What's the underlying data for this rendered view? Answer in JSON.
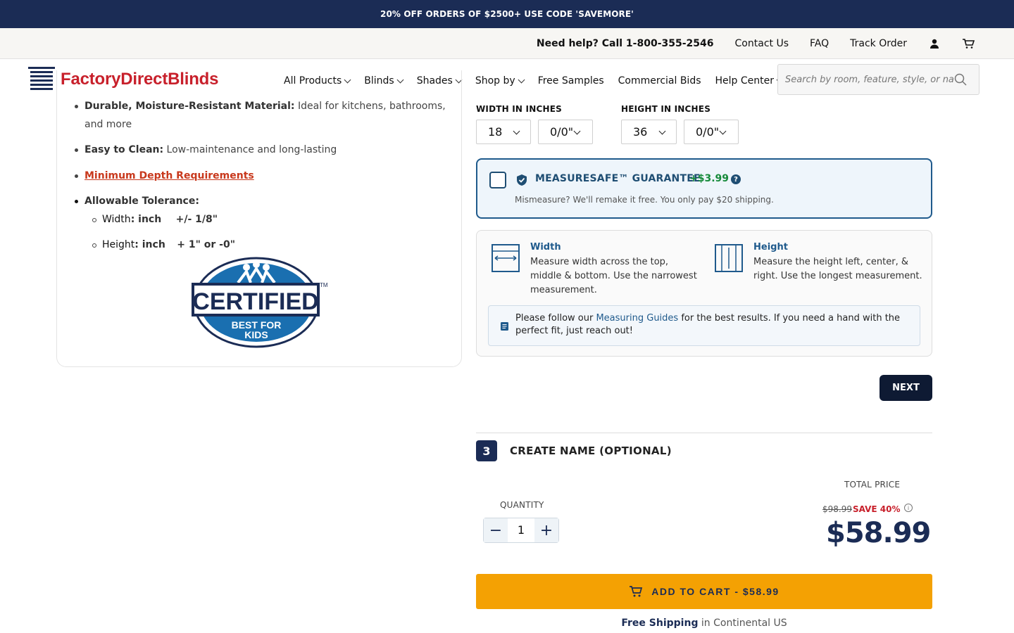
{
  "promo": "20% OFF ORDERS OF $2500+ USE CODE 'SAVEMORE'",
  "util": {
    "help": "Need help? Call 1-800-355-2546",
    "contact": "Contact Us",
    "faq": "FAQ",
    "track": "Track Order",
    "account_icon": "user-icon",
    "cart_icon": "cart-icon"
  },
  "brand": {
    "name": "FactoryDirectBlinds",
    "color": "#c8202b",
    "navy": "#1b2c55"
  },
  "nav": {
    "items": [
      "All Products",
      "Blinds",
      "Shades",
      "Shop by",
      "Free Samples",
      "Commercial Bids",
      "Help Center"
    ],
    "search_placeholder": "Search by room, feature, style, or name"
  },
  "features": {
    "durable_bold": "Durable, Moisture-Resistant Material:",
    "durable_rest1": " Ideal for kitchens, bathrooms,",
    "durable_rest2": "and more",
    "clean_bold": "Easy to Clean:",
    "clean_rest": " Low-maintenance and long-lasting",
    "depth_link": "Minimum Depth Requirements",
    "tolerance": "Allowable Tolerance:",
    "width_label": "Width",
    "width_unit": ": inch",
    "width_val": "+/- 1/8\"",
    "height_label": "Height",
    "height_unit": ": inch",
    "height_val": "+ 1\" or -0\""
  },
  "badge": {
    "line1": "CERTIFIED",
    "line2": "BEST FOR",
    "line3": "KIDS",
    "tm": "TM"
  },
  "dimensions": {
    "width_label": "WIDTH IN INCHES",
    "height_label": "HEIGHT IN INCHES",
    "width_whole": "18",
    "width_fraction": "0/0\"",
    "height_whole": "36",
    "height_fraction": "0/0\""
  },
  "guarantee": {
    "title": "MEASURESAFE™ GUARANTEE",
    "price": "+$3.99",
    "help_icon": "?",
    "subtitle": "Mismeasure? We'll remake it free. You only pay $20 shipping."
  },
  "measure": {
    "width_title": "Width",
    "width_desc": "Measure width across the top, middle & bottom. Use the narrowest measurement.",
    "height_title": "Height",
    "height_desc": "Measure the height left, center, & right. Use the longest measurement.",
    "note_pre": "Please follow our ",
    "note_link": "Measuring Guides",
    "note_post": " for the best results. If you need a hand with the perfect fit, just reach out!"
  },
  "next_label": "NEXT",
  "step3": {
    "number": "3",
    "title": "CREATE NAME (OPTIONAL)"
  },
  "quantity": {
    "label": "QUANTITY",
    "value": "1",
    "minus": "−",
    "plus": "+"
  },
  "pricing": {
    "label": "TOTAL PRICE",
    "original": "$98.99",
    "save": "SAVE 40%",
    "info": "i",
    "price": "$58.99"
  },
  "cart": {
    "label": "ADD TO CART - $58.99",
    "accent": "#f4a103"
  },
  "shipping": {
    "bold": "Free Shipping",
    "rest": " in Continental US"
  }
}
